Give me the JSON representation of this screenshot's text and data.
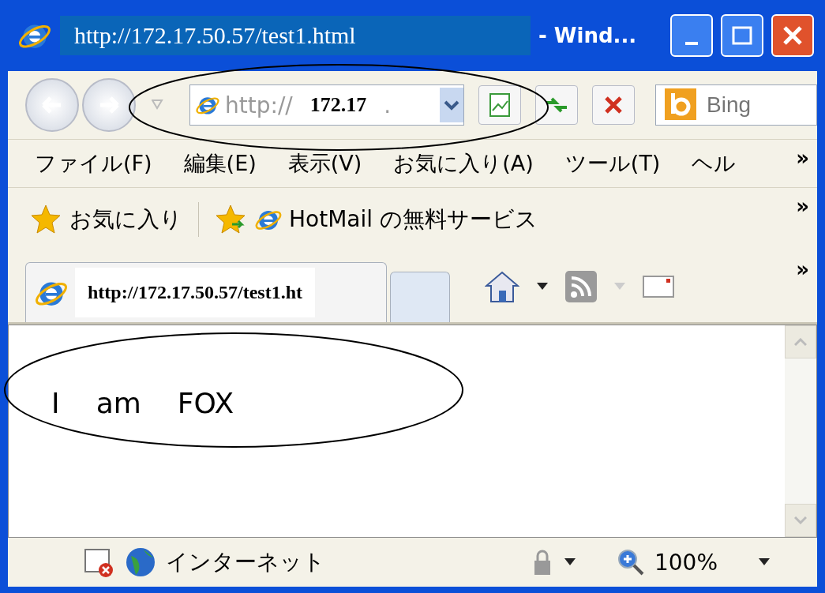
{
  "window": {
    "title": "http://172.17.50.57/test1.html",
    "app_title": "- Wind..."
  },
  "navigation": {
    "address_prefix": "http://",
    "address_highlight": "172.17",
    "address_suffix": ".",
    "search_placeholder": "Bing"
  },
  "menu": {
    "items": [
      "ファイル(F)",
      "編集(E)",
      "表示(V)",
      "お気に入り(A)",
      "ツール(T)",
      "ヘル"
    ],
    "more": "»"
  },
  "favorites_bar": {
    "label": "お気に入り",
    "links": [
      "HotMail の無料サービス"
    ],
    "more": "»"
  },
  "tabs": [
    {
      "label": "http://172.17.50.57/test1.ht",
      "selected": true
    }
  ],
  "tab_toolbar_more": "»",
  "page": {
    "words": [
      "I",
      "am",
      "FOX"
    ]
  },
  "status_bar": {
    "zone": "インターネット",
    "zoom": "100%"
  }
}
